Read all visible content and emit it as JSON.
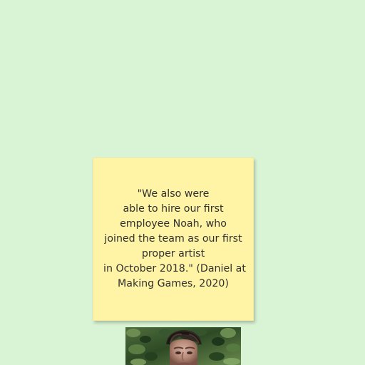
{
  "sticky_note": {
    "lines": [
      "\"We also were",
      "able to hire our first",
      "employee Noah, who",
      "joined the team as our first",
      "proper artist",
      "in October 2018.\" (Daniel at",
      "Making Games, 2020)"
    ]
  },
  "photo": {
    "icon": "person-photo"
  },
  "colors": {
    "background": "#d9f4d4",
    "note": "#fff3a6",
    "text": "#303030"
  }
}
